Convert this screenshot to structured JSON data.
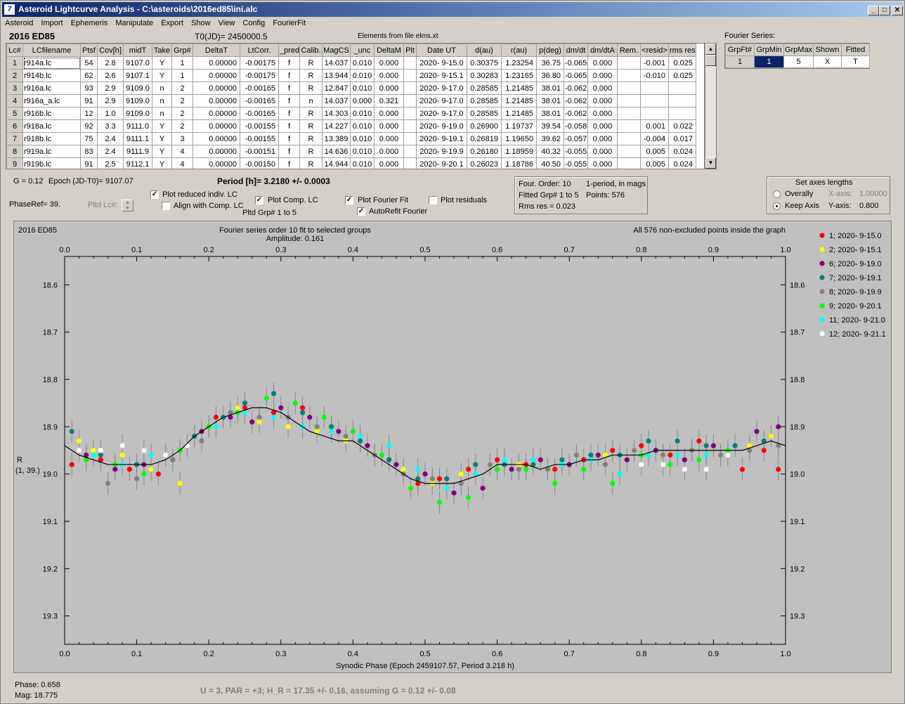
{
  "window": {
    "title": "Asteroid Lightcurve Analysis - C:\\asteroids\\2016ed85\\ini.alc",
    "minimize": "_",
    "maximize": "□",
    "close": "✕"
  },
  "menu": [
    "Asteroid",
    "Import",
    "Ephemeris",
    "Manipulate",
    "Export",
    "Show",
    "View",
    "Config",
    "FourierFit"
  ],
  "header": {
    "object": "2016 ED85",
    "t0": "T0(JD)= 2450000.5",
    "elements": "Elements from file elms.xt",
    "fourier_label": "Fourier Series:"
  },
  "table": {
    "columns": [
      "Lc#",
      "LCfilename",
      "Ptsf",
      "Cov[h]",
      "midT",
      "Take",
      "Grp#",
      "DeltaT",
      "LtCorr.",
      "_pred.",
      "Calib.",
      "MagCS",
      "_unc",
      "DeltaM",
      "Plt",
      "Date UT",
      "d(au)",
      "r(au)",
      "p(deg)",
      "dm/dt",
      "dm/dtA",
      "Rem.",
      "<resid>",
      "rms res"
    ],
    "rows": [
      [
        "1",
        "r914a.lc",
        "54",
        "2.8",
        "9107.0",
        "Y",
        "1",
        "0.00000",
        "-0.00175",
        "f",
        "R",
        "14.037",
        "0.010",
        "0.000",
        "",
        "2020- 9-15.0",
        "0.30375",
        "1.23254",
        "36.75",
        "-0.065",
        "0.000",
        "",
        "-0.001",
        "0.025"
      ],
      [
        "2",
        "r914b.lc",
        "62",
        "2.6",
        "9107.1",
        "Y",
        "1",
        "0.00000",
        "-0.00175",
        "f",
        "R",
        "13.944",
        "0.010",
        "0.000",
        "",
        "2020- 9-15.1",
        "0.30283",
        "1.23165",
        "36.80",
        "-0.065",
        "0.000",
        "",
        "-0.010",
        "0.025"
      ],
      [
        "3",
        "r916a.lc",
        "93",
        "2.9",
        "9109.0",
        "n",
        "2",
        "0.00000",
        "-0.00165",
        "f",
        "R",
        "12.847",
        "0.010",
        "0.000",
        "",
        "2020- 9-17.0",
        "0.28585",
        "1.21485",
        "38.01",
        "-0.062",
        "0.000",
        "",
        "",
        ""
      ],
      [
        "4",
        "r916a_a.lc",
        "91",
        "2.9",
        "9109.0",
        "n",
        "2",
        "0.00000",
        "-0.00165",
        "f",
        "n",
        "14.037",
        "0.000",
        "0.321",
        "",
        "2020- 9-17.0",
        "0.28585",
        "1.21485",
        "38.01",
        "-0.062",
        "0.000",
        "",
        "",
        ""
      ],
      [
        "5",
        "r916b.lc",
        "12",
        "1.0",
        "9109.0",
        "n",
        "2",
        "0.00000",
        "-0.00165",
        "f",
        "R",
        "14.303",
        "0.010",
        "0.000",
        "",
        "2020- 9-17.0",
        "0.28585",
        "1.21485",
        "38.01",
        "-0.062",
        "0.000",
        "",
        "",
        ""
      ],
      [
        "6",
        "r918a.lc",
        "92",
        "3.3",
        "9111.0",
        "Y",
        "2",
        "0.00000",
        "-0.00155",
        "f",
        "R",
        "14.227",
        "0.010",
        "0.000",
        "",
        "2020- 9-19.0",
        "0.26900",
        "1.19737",
        "39.54",
        "-0.058",
        "0.000",
        "",
        "0.001",
        "0.022"
      ],
      [
        "7",
        "r918b.lc",
        "75",
        "2.4",
        "9111.1",
        "Y",
        "3",
        "0.00000",
        "-0.00155",
        "f",
        "R",
        "13.389",
        "0.010",
        "0.000",
        "",
        "2020- 9-19.1",
        "0.26819",
        "1.19650",
        "39.62",
        "-0.057",
        "0.000",
        "",
        "-0.004",
        "0.017"
      ],
      [
        "8",
        "r919a.lc",
        "83",
        "2.4",
        "9111.9",
        "Y",
        "4",
        "0.00000",
        "-0.00151",
        "f",
        "R",
        "14.636",
        "0.010",
        "0.000",
        "",
        "2020- 9-19.9",
        "0.26180",
        "1.18959",
        "40.32",
        "-0.055",
        "0.000",
        "",
        "0.005",
        "0.024"
      ],
      [
        "9",
        "r919b.lc",
        "91",
        "2.5",
        "9112.1",
        "Y",
        "4",
        "0.00000",
        "-0.00150",
        "f",
        "R",
        "14.944",
        "0.010",
        "0.000",
        "",
        "2020- 9-20.1",
        "0.26023",
        "1.18786",
        "40.50",
        "-0.055",
        "0.000",
        "",
        "0.005",
        "0.024"
      ]
    ]
  },
  "fourier_table": {
    "columns": [
      "GrpFt#",
      "GrpMin",
      "GrpMax",
      "Shown",
      "Fitted"
    ],
    "row": [
      "1",
      "1",
      "5",
      "X",
      "T"
    ]
  },
  "controls": {
    "g": "G = 0.12",
    "epoch": "Epoch (JD-T0)= 9107.07",
    "period": "Period [h]= 3.2180 +/- 0.0003",
    "phaseref": "PhaseRef= 39.",
    "pltd_lc": "Pltd Lc#:",
    "plot_reduced": "Plot reduced indiv. LC",
    "align": "Align with Comp. LC",
    "plot_comp": "Plot Comp. LC",
    "pltd_grp": "Pltd Grp#  1   to   5",
    "plot_fourier": "Plot Fourier Fit",
    "autorefit": "AutoRefit Fourier",
    "plot_residuals": "Plot residuals"
  },
  "fit_info": {
    "order": "Four. Order: 10",
    "mode": "1-period, in mags",
    "fitted": "Fitted Grp# 1 to 5",
    "points": "Points: 576",
    "rms": "Rms res     = 0.023"
  },
  "axes_box": {
    "title": "Set axes lengths",
    "overall": "Overally",
    "keep": "Keep Axis",
    "xaxis_lbl": "X-axis:",
    "xaxis_val": "1.00000",
    "yaxis_lbl": "Y-axis:",
    "yaxis_val": "0.800"
  },
  "chart_data": {
    "type": "scatter",
    "title": "Fourier series order 10 fit to selected groups",
    "subtitle": "Amplitude: 0.161",
    "object_label": "2016 ED85",
    "points_note": "All 576 non-excluded points inside the graph",
    "xlabel": "Synodic Phase (Epoch 2459107.57, Period 3.218 h)",
    "ylabel": "R",
    "ylabel2": "(1, 39.)",
    "xlim": [
      0.0,
      1.0
    ],
    "ylim": [
      19.36,
      18.54
    ],
    "y_inverted": true,
    "x_ticks": [
      "0.0",
      "0.1",
      "0.2",
      "0.3",
      "0.4",
      "0.5",
      "0.6",
      "0.7",
      "0.8",
      "0.9",
      "1.0"
    ],
    "y_ticks": [
      "18.6",
      "18.7",
      "18.8",
      "18.9",
      "19.0",
      "19.1",
      "19.2",
      "19.3"
    ],
    "grid": false,
    "legend_placement": "right",
    "series": [
      {
        "name": "1; 2020- 9-15.0",
        "color": "#ff0000",
        "x": [
          0.01,
          0.05,
          0.09,
          0.13,
          0.18,
          0.21,
          0.25,
          0.29,
          0.33,
          0.37,
          0.41,
          0.45,
          0.49,
          0.52,
          0.56,
          0.6,
          0.64,
          0.68,
          0.72,
          0.76,
          0.8,
          0.84,
          0.88,
          0.94,
          0.97,
          0.99
        ],
        "y": [
          18.98,
          18.97,
          18.99,
          19.0,
          18.92,
          18.88,
          18.86,
          18.87,
          18.86,
          18.9,
          18.93,
          18.97,
          19.02,
          19.01,
          18.99,
          18.97,
          18.98,
          18.99,
          18.97,
          18.95,
          18.94,
          18.96,
          18.93,
          18.99,
          18.95,
          18.99
        ]
      },
      {
        "name": "2; 2020- 9-15.1",
        "color": "#ffff00",
        "x": [
          0.02,
          0.04,
          0.08,
          0.12,
          0.16,
          0.2,
          0.24,
          0.27,
          0.31,
          0.35,
          0.39,
          0.43,
          0.47,
          0.51,
          0.55,
          0.59,
          0.63,
          0.67,
          0.71,
          0.75,
          0.79,
          0.83,
          0.87,
          0.91,
          0.95,
          0.98
        ],
        "y": [
          18.93,
          18.95,
          18.96,
          18.99,
          19.02,
          18.9,
          18.86,
          18.89,
          18.9,
          18.91,
          18.93,
          18.96,
          18.99,
          19.02,
          19.0,
          18.98,
          18.98,
          18.99,
          18.96,
          18.96,
          18.95,
          18.96,
          18.95,
          18.96,
          18.94,
          18.92
        ]
      },
      {
        "name": "6; 2020- 9-19.0",
        "color": "#800080",
        "x": [
          0.03,
          0.07,
          0.11,
          0.15,
          0.19,
          0.23,
          0.26,
          0.3,
          0.34,
          0.38,
          0.42,
          0.46,
          0.5,
          0.54,
          0.58,
          0.62,
          0.66,
          0.7,
          0.74,
          0.78,
          0.82,
          0.86,
          0.9,
          0.96,
          0.99
        ],
        "y": [
          18.96,
          18.99,
          18.98,
          18.97,
          18.91,
          18.88,
          18.89,
          18.86,
          18.88,
          18.91,
          18.94,
          18.98,
          19.0,
          19.04,
          19.03,
          18.99,
          18.97,
          18.98,
          18.96,
          18.97,
          18.95,
          18.97,
          18.94,
          18.91,
          18.9
        ]
      },
      {
        "name": "7; 2020- 9-19.1",
        "color": "#008080",
        "x": [
          0.01,
          0.05,
          0.1,
          0.14,
          0.18,
          0.22,
          0.25,
          0.29,
          0.33,
          0.37,
          0.41,
          0.45,
          0.49,
          0.53,
          0.57,
          0.61,
          0.65,
          0.69,
          0.73,
          0.77,
          0.81,
          0.85,
          0.89,
          0.93,
          0.97
        ],
        "y": [
          18.91,
          18.96,
          18.98,
          18.96,
          18.92,
          18.88,
          18.85,
          18.83,
          18.87,
          18.9,
          18.93,
          18.97,
          19.01,
          19.01,
          18.98,
          18.98,
          18.98,
          18.97,
          18.96,
          18.96,
          18.93,
          18.93,
          18.94,
          18.94,
          18.93
        ]
      },
      {
        "name": "8; 2020- 9-19.9",
        "color": "#808080",
        "x": [
          0.02,
          0.06,
          0.1,
          0.15,
          0.19,
          0.23,
          0.27,
          0.31,
          0.35,
          0.39,
          0.43,
          0.47,
          0.51,
          0.55,
          0.59,
          0.63,
          0.67,
          0.71,
          0.75,
          0.79,
          0.83,
          0.87,
          0.91,
          0.95,
          0.99
        ],
        "y": [
          18.95,
          19.02,
          19.01,
          18.97,
          18.93,
          18.87,
          18.88,
          18.88,
          18.9,
          18.92,
          18.96,
          19.0,
          19.01,
          19.02,
          18.98,
          18.99,
          18.99,
          18.96,
          18.98,
          18.95,
          18.96,
          18.95,
          18.96,
          18.95,
          18.94
        ]
      },
      {
        "name": "9; 2020- 9-20.1",
        "color": "#00ff00",
        "x": [
          0.03,
          0.07,
          0.11,
          0.16,
          0.2,
          0.24,
          0.28,
          0.32,
          0.36,
          0.4,
          0.44,
          0.48,
          0.52,
          0.56,
          0.6,
          0.64,
          0.68,
          0.72,
          0.76,
          0.8,
          0.84,
          0.88,
          0.92
        ],
        "y": [
          18.97,
          18.98,
          19.0,
          18.95,
          18.9,
          18.87,
          18.84,
          18.85,
          18.88,
          18.91,
          18.96,
          19.03,
          19.06,
          19.05,
          18.99,
          18.99,
          19.02,
          18.99,
          19.02,
          18.96,
          18.98,
          18.97,
          18.95
        ]
      },
      {
        "name": "11; 2020- 9-21.0",
        "color": "#00ffff",
        "x": [
          0.04,
          0.08,
          0.12,
          0.17,
          0.21,
          0.25,
          0.29,
          0.33,
          0.37,
          0.41,
          0.45,
          0.49,
          0.53,
          0.57,
          0.61,
          0.65,
          0.69,
          0.73,
          0.77,
          0.81,
          0.85,
          0.89
        ],
        "y": [
          18.96,
          18.98,
          18.96,
          18.94,
          18.9,
          18.87,
          18.88,
          18.9,
          18.91,
          18.92,
          18.94,
          18.99,
          19.03,
          19.0,
          18.97,
          18.97,
          18.98,
          18.97,
          19.0,
          18.96,
          18.96,
          18.96
        ]
      },
      {
        "name": "12; 2020- 9-21.1",
        "color": "#ffffff",
        "x": [
          0.02,
          0.05,
          0.08,
          0.11,
          0.14,
          0.17,
          0.8,
          0.83,
          0.86,
          0.89,
          0.92
        ],
        "y": [
          18.95,
          18.95,
          18.94,
          18.95,
          18.96,
          18.94,
          18.98,
          18.98,
          18.99,
          18.99,
          18.96
        ]
      }
    ],
    "fit_curve": {
      "x": [
        0.0,
        0.02,
        0.04,
        0.06,
        0.08,
        0.1,
        0.12,
        0.14,
        0.16,
        0.18,
        0.2,
        0.22,
        0.24,
        0.26,
        0.28,
        0.3,
        0.32,
        0.34,
        0.36,
        0.38,
        0.4,
        0.42,
        0.44,
        0.46,
        0.48,
        0.5,
        0.52,
        0.54,
        0.56,
        0.58,
        0.6,
        0.62,
        0.64,
        0.66,
        0.68,
        0.7,
        0.72,
        0.74,
        0.76,
        0.78,
        0.8,
        0.82,
        0.84,
        0.86,
        0.88,
        0.9,
        0.92,
        0.94,
        0.96,
        0.98,
        1.0
      ],
      "y": [
        18.94,
        18.96,
        18.97,
        18.98,
        18.98,
        18.98,
        18.98,
        18.97,
        18.95,
        18.92,
        18.9,
        18.88,
        18.87,
        18.86,
        18.86,
        18.87,
        18.89,
        18.91,
        18.92,
        18.93,
        18.93,
        18.95,
        18.97,
        18.99,
        19.01,
        19.02,
        19.02,
        19.02,
        19.01,
        19.0,
        18.98,
        18.98,
        18.98,
        18.99,
        18.98,
        18.98,
        18.97,
        18.97,
        18.96,
        18.96,
        18.96,
        18.95,
        18.95,
        18.95,
        18.95,
        18.95,
        18.95,
        18.95,
        18.94,
        18.93,
        18.94
      ]
    }
  },
  "status": {
    "phase": "Phase:  0.658",
    "mag": "Mag:    18.775",
    "ephem": "U = 3, PAR = +3; H_R = 17.35 +/- 0.16, assuming G = 0.12 +/- 0.08"
  }
}
